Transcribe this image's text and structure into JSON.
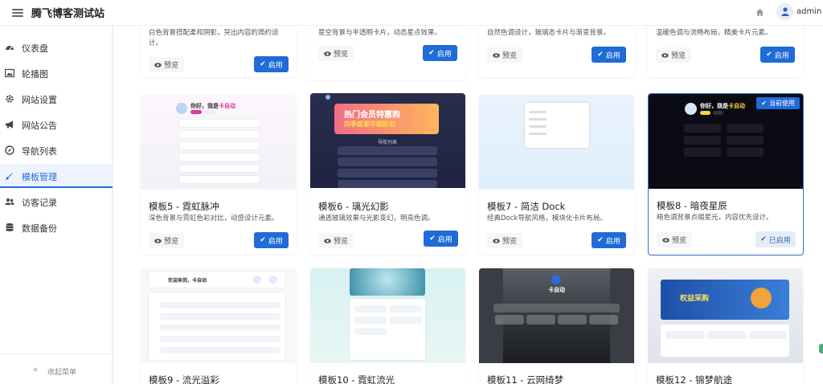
{
  "header": {
    "site_name": "腾飞博客测试站",
    "user": "admin",
    "icons": [
      "hamburger-icon",
      "home-icon",
      "user-icon"
    ]
  },
  "sidebar": {
    "items": [
      {
        "label": "仪表盘",
        "icon": "dashboard-icon"
      },
      {
        "label": "轮播图",
        "icon": "image-icon"
      },
      {
        "label": "网站设置",
        "icon": "gear-icon"
      },
      {
        "label": "网站公告",
        "icon": "bullhorn-icon"
      },
      {
        "label": "导航列表",
        "icon": "compass-icon"
      },
      {
        "label": "模板管理",
        "icon": "paintbrush-icon",
        "active": true
      },
      {
        "label": "访客记录",
        "icon": "users-icon"
      },
      {
        "label": "数据备份",
        "icon": "database-icon"
      }
    ],
    "collapse_label": "收起菜单"
  },
  "templates": {
    "top_row": [
      {
        "desc_line1": "白色背景搭配柔和阴影，突出内容的简约设",
        "desc_line2": "计。",
        "preview": "预览",
        "action": "启用"
      },
      {
        "desc_line1": "星空背景与半透明卡片，动态星点效果。",
        "preview": "预览",
        "action": "启用"
      },
      {
        "desc_line1": "自然色调设计，玻璃态卡片与渐变背景。",
        "preview": "预览",
        "action": "启用"
      },
      {
        "desc_line1": "温暖色调与流畅布局，精美卡片元素。",
        "preview": "预览",
        "action": "启用"
      }
    ],
    "middle_row": [
      {
        "title": "模板5 - 霓虹脉冲",
        "desc": "深色背景与霓虹色彩对比，动感设计元素。",
        "preview": "预览",
        "action": "启用",
        "thumb": {
          "hello": "你好，我是",
          "name": "卡自动"
        }
      },
      {
        "title": "模板6 - 璃光幻影",
        "desc": "通透玻璃效果与光影变幻，明亮色调。",
        "preview": "预览",
        "action": "启用",
        "thumb": {
          "banner1": "热门会员特惠购",
          "banner2": "四季度豪华超折扣",
          "section": "导航列表"
        }
      },
      {
        "title": "模板7 - 简洁 Dock",
        "desc": "经典Dock导航风格，模块化卡片布局。",
        "preview": "预览",
        "action": "启用"
      },
      {
        "title": "模板8 - 暗夜星辰",
        "desc": "暗色调背景点缀星光，内容优先设计。",
        "preview": "预览",
        "action": "已启用",
        "badge": "当前使用",
        "current": true,
        "thumb": {
          "hello": "你好，我是",
          "name": "卡自动"
        }
      }
    ],
    "bottom_row": [
      {
        "title": "模板9 - 流光溢彩",
        "thumb": {
          "welcome": "欢迎来到，卡自动"
        }
      },
      {
        "title": "模板10 - 霓虹流光"
      },
      {
        "title": "模板11 - 云网绮梦",
        "thumb": {
          "name": "卡自动"
        }
      },
      {
        "title": "模板12 - 锦梦航途",
        "thumb": {
          "banner": "权益采购"
        }
      }
    ]
  },
  "colors": {
    "primary": "#1f6bd7",
    "active_bg": "#eef3fd",
    "dark_thumb": "#0b0b14"
  }
}
